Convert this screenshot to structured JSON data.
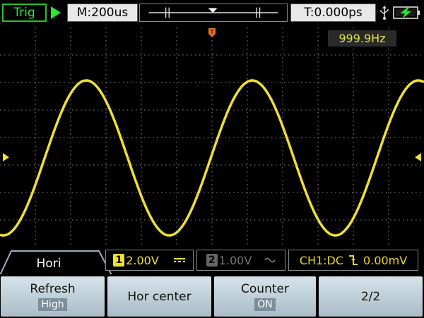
{
  "topbar": {
    "trigger_status": "Trig",
    "timebase": "M:200us",
    "trigger_time": "T:0.000ps",
    "usb_icon": "usb-icon",
    "battery_icon": "battery-charging-icon"
  },
  "screen": {
    "frequency": "999.9Hz",
    "grid_divisions": {
      "horizontal": 12,
      "vertical": 8
    },
    "waveform_color": "#f0e030",
    "trigger_marker_icon": "trigger-position-icon",
    "ch1_level_icon": "ch1-ground-marker-icon"
  },
  "status": {
    "tab_label": "Hori",
    "ch1_number": "1",
    "ch1_scale": "2.00V",
    "ch1_coupling_icon": "dc-coupling-icon",
    "ch2_number": "2",
    "ch2_scale": "1.00V",
    "ch2_coupling_icon": "ac-coupling-icon",
    "trigger_info": "CH1:DC",
    "trigger_slope_icon": "falling-edge-icon",
    "trigger_level": "0.00mV"
  },
  "menu": [
    {
      "label": "Refresh",
      "value": "High"
    },
    {
      "label": "Hor center",
      "value": ""
    },
    {
      "label": "Counter",
      "value": "ON"
    },
    {
      "label": "2/2",
      "value": ""
    }
  ],
  "colors": {
    "ch1": "#f0e030",
    "ch2_disabled": "#777777",
    "trig_green": "#2ce82c",
    "menu_button": "#c0d0d8"
  }
}
